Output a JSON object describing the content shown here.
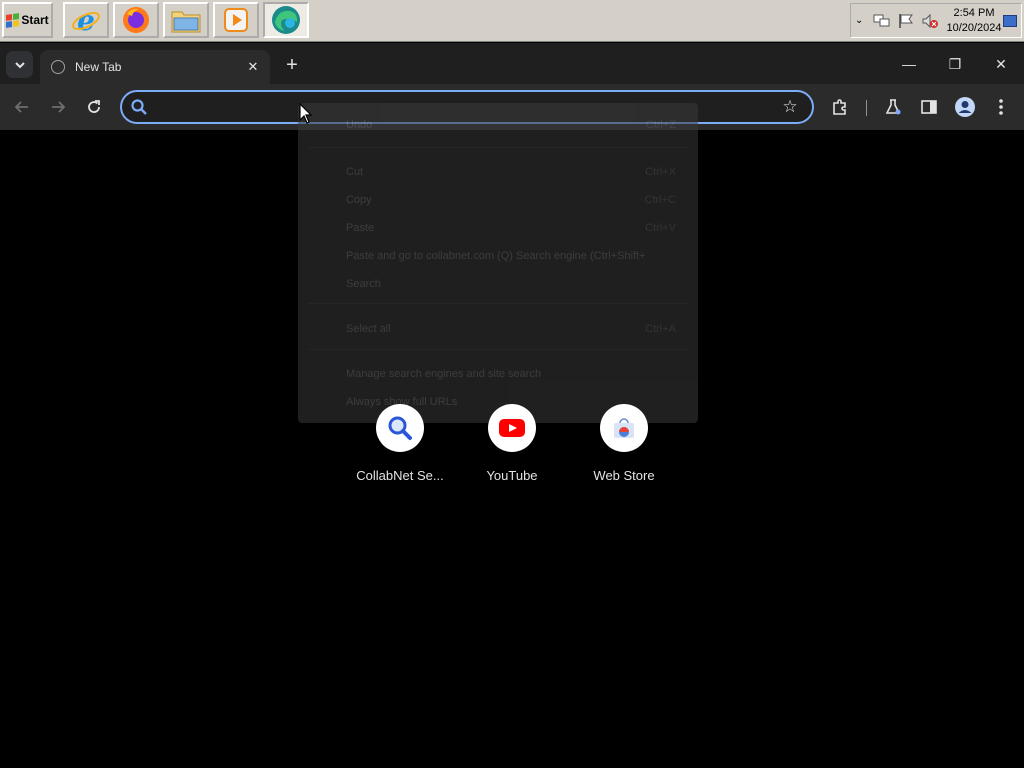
{
  "taskbar": {
    "start_label": "Start",
    "quick_launch": [
      "internet-explorer",
      "firefox",
      "file-explorer",
      "media-player",
      "edge"
    ],
    "clock_time": "2:54 PM",
    "clock_date": "10/20/2024"
  },
  "browser": {
    "tab_title": "New Tab",
    "tab_close": "✕",
    "new_tab": "+",
    "window_controls": {
      "minimize": "—",
      "restore": "❐",
      "close": "✕"
    },
    "omnibox": {
      "value": "",
      "placeholder": ""
    }
  },
  "context_menu": {
    "items": [
      {
        "label": "Undo",
        "shortcut": "Ctrl+Z"
      },
      {
        "label": "Cut",
        "shortcut": "Ctrl+X"
      },
      {
        "label": "Copy",
        "shortcut": "Ctrl+C"
      },
      {
        "label": "Paste",
        "shortcut": "Ctrl+V"
      },
      {
        "label": "Paste and go to collabnet.com (Q) Search engine (Ctrl+Shift+",
        "shortcut": ""
      },
      {
        "label": "Search",
        "shortcut": ""
      },
      {
        "label": "Select all",
        "shortcut": "Ctrl+A"
      },
      {
        "label": "Manage search engines and site search",
        "shortcut": ""
      },
      {
        "label": "Always show full URLs",
        "shortcut": ""
      }
    ]
  },
  "shortcuts": [
    {
      "label": "CollabNet Se...",
      "icon": "search-icon"
    },
    {
      "label": "YouTube",
      "icon": "youtube-icon"
    },
    {
      "label": "Web Store",
      "icon": "web-store-icon"
    }
  ]
}
